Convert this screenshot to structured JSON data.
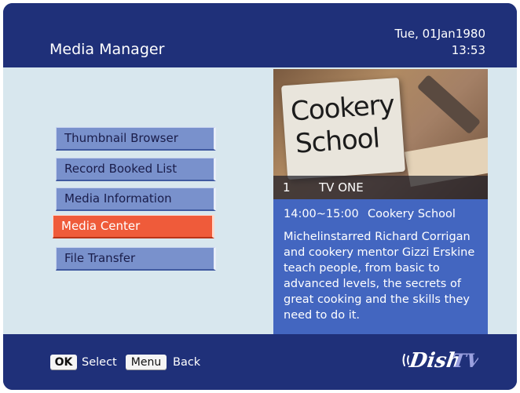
{
  "header": {
    "title": "Media Manager",
    "date": "Tue, 01Jan1980",
    "time": "13:53"
  },
  "menu": {
    "items": [
      {
        "label": "Thumbnail Browser"
      },
      {
        "label": "Record Booked List"
      },
      {
        "label": "Media Information"
      },
      {
        "label": "Media Center"
      },
      {
        "label": "File Transfer"
      }
    ],
    "selected": "Media Center"
  },
  "preview": {
    "image_text_line1": "Cookery",
    "image_text_line2": "School",
    "channel_number": "1",
    "channel_name": "TV ONE"
  },
  "program": {
    "time": "14:00~15:00",
    "name": "Cookery School",
    "description": "Michelinstarred Richard Corrigan and cookery mentor Gizzi Erskine teach people, from basic to advanced levels, the secrets of great cooking and the skills they need to do it."
  },
  "footer": {
    "ok_key": "OK",
    "ok_label": "Select",
    "menu_key": "Menu",
    "menu_label": "Back",
    "logo_text": "Dish TV"
  },
  "colors": {
    "frame": "#1f3079",
    "content_bg": "#d8e7ee",
    "menu_item": "#7991cc",
    "menu_selected": "#ef5b3a",
    "info_panel": "#4366c0"
  }
}
